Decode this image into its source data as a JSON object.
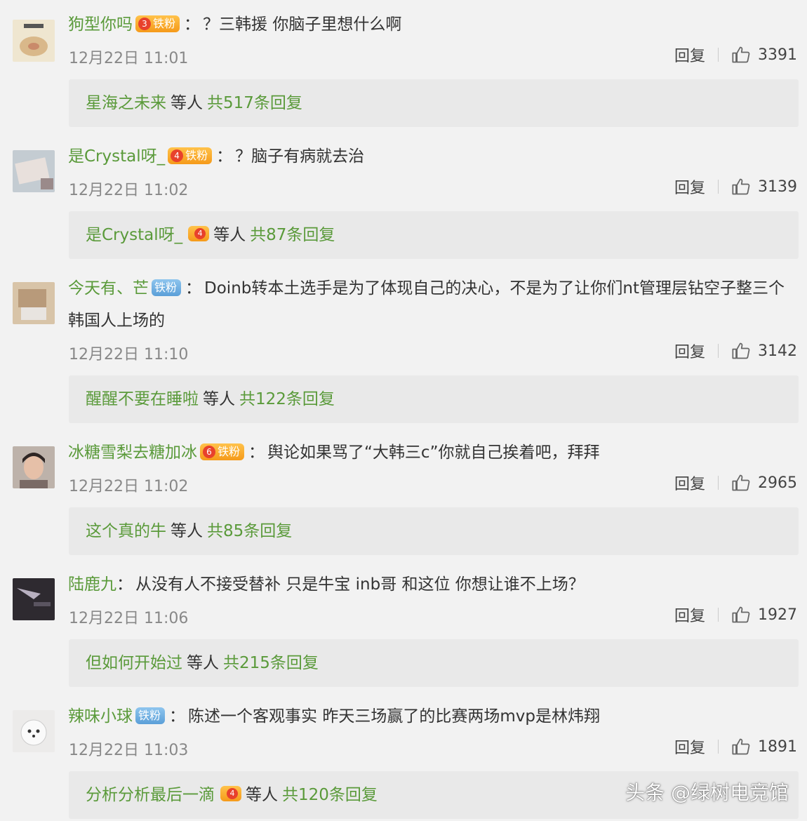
{
  "comments": [
    {
      "username": "狗型你吗",
      "badge": {
        "text": "铁粉",
        "level": "3",
        "style": "orange"
      },
      "colon": "：",
      "text": "？三韩援 你脑子里想什么啊",
      "time": "12月22日 11:01",
      "reply_label": "回复",
      "likes": "3391",
      "reply_summary": {
        "name": "星海之未来",
        "mid": "等人",
        "count": "共517条回复",
        "badge_level": ""
      },
      "avatar_color": "#e9d9b8"
    },
    {
      "username": "是Crystal呀_",
      "badge": {
        "text": "铁粉",
        "level": "4",
        "style": "orange"
      },
      "colon": "：",
      "text": "？脑子有病就去治",
      "time": "12月22日 11:02",
      "reply_label": "回复",
      "likes": "3139",
      "reply_summary": {
        "name": "是Crystal呀_",
        "mid": "等人",
        "count": "共87条回复",
        "badge_level": "4"
      },
      "avatar_color": "#b9c6cf"
    },
    {
      "username": "今天有、芒",
      "badge": {
        "text": "铁粉",
        "level": "",
        "style": "blue"
      },
      "colon": "：",
      "text": "Doinb转本土选手是为了体现自己的决心，不是为了让你们nt管理层钻空子整三个韩国人上场的",
      "time": "12月22日 11:10",
      "reply_label": "回复",
      "likes": "3142",
      "reply_summary": {
        "name": "醒醒不要在睡啦",
        "mid": "等人",
        "count": "共122条回复",
        "badge_level": ""
      },
      "avatar_color": "#c9b49a"
    },
    {
      "username": "冰糖雪梨去糖加冰",
      "badge": {
        "text": "铁粉",
        "level": "6",
        "style": "orange"
      },
      "colon": "：",
      "text": "舆论如果骂了“大韩三c”你就自己挨着吧，拜拜",
      "time": "12月22日 11:02",
      "reply_label": "回复",
      "likes": "2965",
      "reply_summary": {
        "name": "这个真的牛",
        "mid": "等人",
        "count": "共85条回复",
        "badge_level": ""
      },
      "avatar_color": "#a99a8e"
    },
    {
      "username": "陆鹿九",
      "badge": null,
      "colon": "：",
      "text": "从没有人不接受替补 只是牛宝 inb哥 和这位 你想让谁不上场？",
      "time": "12月22日 11:06",
      "reply_label": "回复",
      "likes": "1927",
      "reply_summary": {
        "name": "但如何开始过",
        "mid": "等人",
        "count": "共215条回复",
        "badge_level": ""
      },
      "avatar_color": "#3a3640"
    },
    {
      "username": "辣味小球",
      "badge": {
        "text": "铁粉",
        "level": "",
        "style": "blue"
      },
      "colon": "：",
      "text": "陈述一个客观事实 昨天三场赢了的比赛两场mvp是林炜翔",
      "time": "12月22日 11:03",
      "reply_label": "回复",
      "likes": "1891",
      "reply_summary": {
        "name": "分析分析最后一滴",
        "mid": "等人",
        "count": "共120条回复",
        "badge_level": "4"
      },
      "avatar_color": "#e8e6e4"
    }
  ],
  "watermark": "头条 @绿树电竞馆",
  "colors": {
    "name_green": "#5a9a3a",
    "badge_orange": "#f59a1a",
    "badge_blue": "#5b9fd8",
    "background": "#f2f2f2"
  }
}
